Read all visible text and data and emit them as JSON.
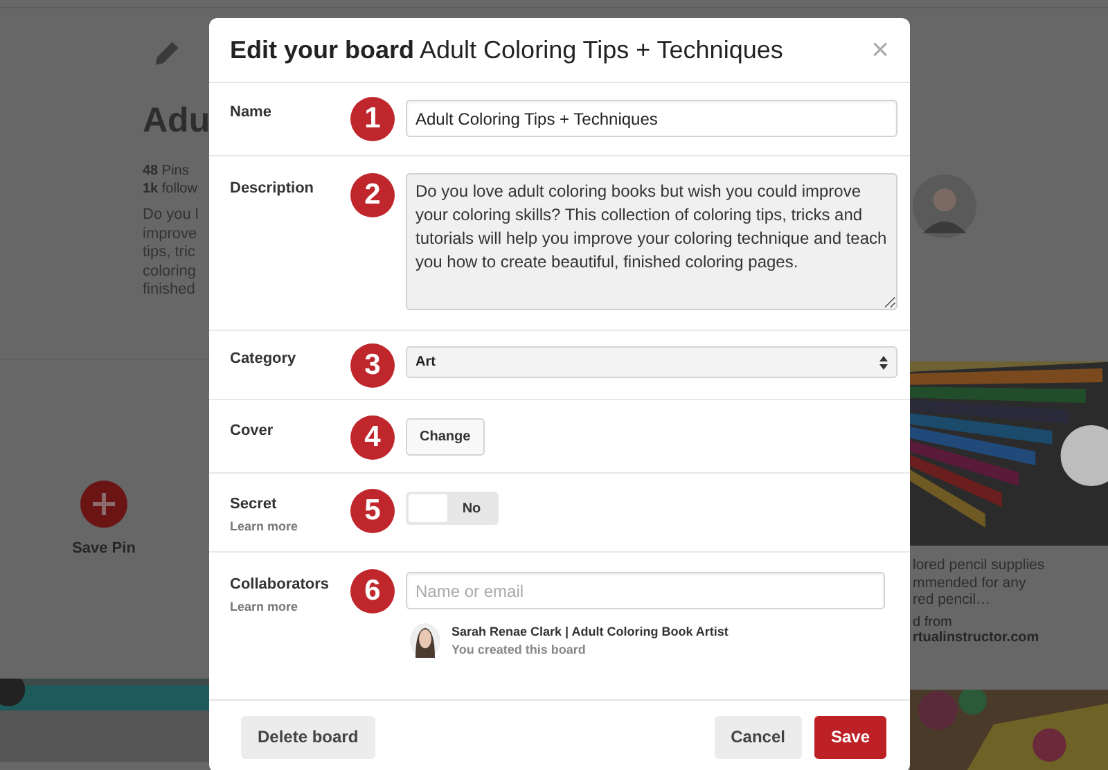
{
  "background_page": {
    "board_title": "Adu",
    "stats": [
      {
        "count": "48",
        "label": "Pins"
      },
      {
        "count": "1k",
        "label": "follow"
      }
    ],
    "description_lines": [
      "Do you l",
      "improve",
      "tips, tric",
      "coloring",
      "finished"
    ],
    "save_pin_label": "Save Pin",
    "pin_caption_lines": [
      "lored pencil supplies",
      "mmended for any",
      "red pencil…"
    ],
    "pin_source_label": "d from",
    "pin_source": "rtualinstructor.com"
  },
  "dialog": {
    "title": "**Edit your board** Adult Coloring Tips + Techniques",
    "close": "×",
    "fields": [
      {
        "kind": "text",
        "label": "Name",
        "step": "1",
        "value": "Adult Coloring Tips + Techniques"
      },
      {
        "kind": "textarea",
        "label": "Description",
        "step": "2",
        "value": "Do you love adult coloring books but wish you could improve your coloring skills? This collection of coloring tips, tricks and tutorials will help you improve your coloring technique and teach you how to create beautiful, finished coloring pages."
      },
      {
        "kind": "select",
        "label": "Category",
        "step": "3",
        "value": "Art"
      },
      {
        "kind": "button",
        "label": "Cover",
        "step": "4",
        "button": "Change"
      },
      {
        "kind": "toggle",
        "label": "Secret",
        "sublabel": "Learn more",
        "step": "5",
        "on": false,
        "state_text": "No"
      },
      {
        "kind": "collaborators",
        "label": "Collaborators",
        "sublabel": "Learn more",
        "step": "6",
        "placeholder": "Name or email",
        "members": [
          {
            "name": "Sarah Renae Clark | Adult Coloring Book Artist",
            "note": "You created this board"
          }
        ]
      }
    ],
    "footer": {
      "delete": "Delete board",
      "cancel": "Cancel",
      "save": "Save"
    }
  }
}
